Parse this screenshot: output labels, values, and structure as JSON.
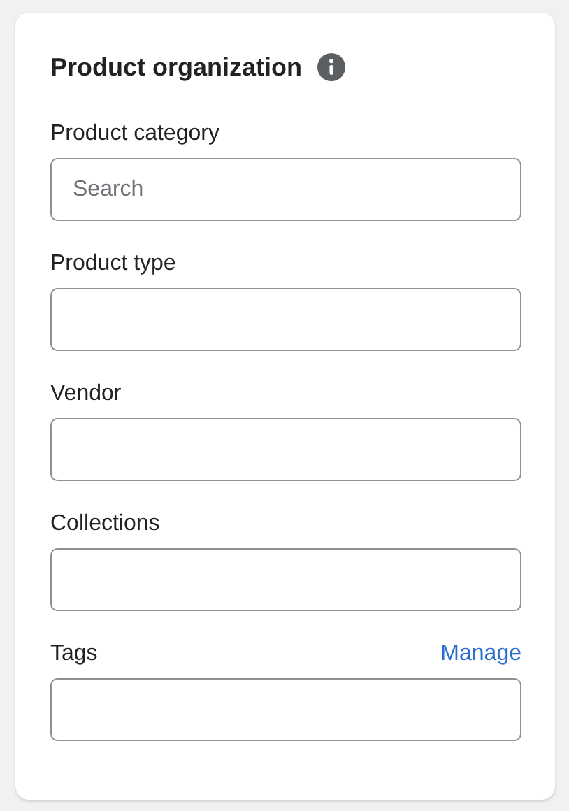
{
  "card": {
    "title": "Product organization"
  },
  "fields": [
    {
      "label": "Product category",
      "placeholder": "Search"
    },
    {
      "label": "Product type"
    },
    {
      "label": "Vendor"
    },
    {
      "label": "Collections"
    },
    {
      "label": "Tags",
      "action": "Manage"
    }
  ]
}
